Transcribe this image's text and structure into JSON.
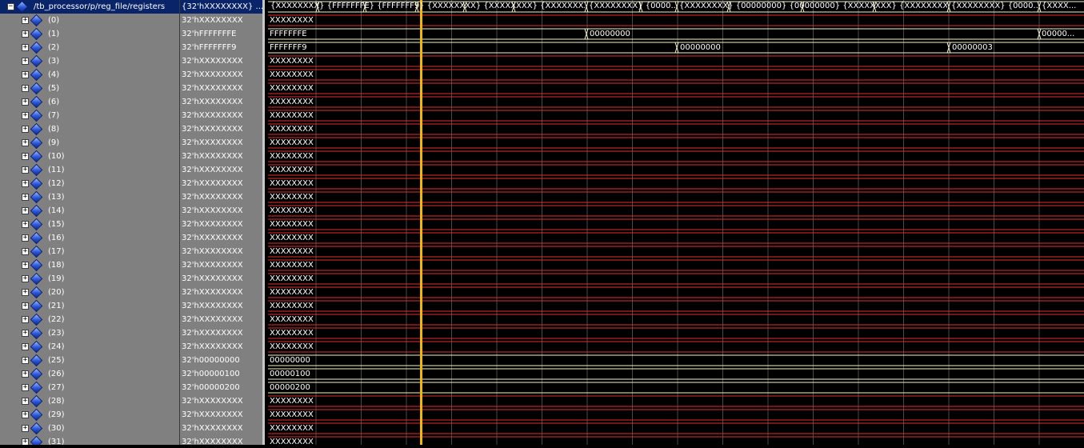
{
  "signal_list": {
    "root": {
      "name": "/tb_processor/p/reg_file/registers",
      "value": "{32'hXXXXXXXX} ...",
      "expanded": true
    },
    "children": [
      {
        "name": "(0)",
        "value": "32'hXXXXXXXX"
      },
      {
        "name": "(1)",
        "value": "32'hFFFFFFFE"
      },
      {
        "name": "(2)",
        "value": "32'hFFFFFFF9"
      },
      {
        "name": "(3)",
        "value": "32'hXXXXXXXX"
      },
      {
        "name": "(4)",
        "value": "32'hXXXXXXXX"
      },
      {
        "name": "(5)",
        "value": "32'hXXXXXXXX"
      },
      {
        "name": "(6)",
        "value": "32'hXXXXXXXX"
      },
      {
        "name": "(7)",
        "value": "32'hXXXXXXXX"
      },
      {
        "name": "(8)",
        "value": "32'hXXXXXXXX"
      },
      {
        "name": "(9)",
        "value": "32'hXXXXXXXX"
      },
      {
        "name": "(10)",
        "value": "32'hXXXXXXXX"
      },
      {
        "name": "(11)",
        "value": "32'hXXXXXXXX"
      },
      {
        "name": "(12)",
        "value": "32'hXXXXXXXX"
      },
      {
        "name": "(13)",
        "value": "32'hXXXXXXXX"
      },
      {
        "name": "(14)",
        "value": "32'hXXXXXXXX"
      },
      {
        "name": "(15)",
        "value": "32'hXXXXXXXX"
      },
      {
        "name": "(16)",
        "value": "32'hXXXXXXXX"
      },
      {
        "name": "(17)",
        "value": "32'hXXXXXXXX"
      },
      {
        "name": "(18)",
        "value": "32'hXXXXXXXX"
      },
      {
        "name": "(19)",
        "value": "32'hXXXXXXXX"
      },
      {
        "name": "(20)",
        "value": "32'hXXXXXXXX"
      },
      {
        "name": "(21)",
        "value": "32'hXXXXXXXX"
      },
      {
        "name": "(22)",
        "value": "32'hXXXXXXXX"
      },
      {
        "name": "(23)",
        "value": "32'hXXXXXXXX"
      },
      {
        "name": "(24)",
        "value": "32'hXXXXXXXX"
      },
      {
        "name": "(25)",
        "value": "32'h00000000"
      },
      {
        "name": "(26)",
        "value": "32'h00000100"
      },
      {
        "name": "(27)",
        "value": "32'h00000200"
      },
      {
        "name": "(28)",
        "value": "32'hXXXXXXXX"
      },
      {
        "name": "(29)",
        "value": "32'hXXXXXXXX"
      },
      {
        "name": "(30)",
        "value": "32'hXXXXXXXX"
      },
      {
        "name": "(31)",
        "value": "32'hXXXXXXXX"
      }
    ]
  },
  "waveform": {
    "top_row_labels": [
      "{XXXXXXXX} {FFFFFFFE} {FFFFFFF9} {XXXXXXXX} {XXXXXXXX} {XXXXXXXX} {X...",
      "{XXXXXXXX} {0000...",
      "{XXXXXXXX} {00000000} {00000000} {XXXXXXXX} {XXXXXXXX} {X...",
      "{XXXXXXXX} {0000...",
      "{XXXX..."
    ],
    "row_events": {
      "1": [
        "FFFFFFFE",
        "00000000",
        "00000..."
      ],
      "2": [
        "FFFFFFF9",
        "00000000",
        "00000003"
      ]
    },
    "unknown_label": "XXXXXXXX",
    "colors": {
      "unknown": "#e03030",
      "known": "#f2f2d0",
      "grid": "#4a4a4a",
      "cursor": "#f0b800",
      "selection": "#0a246a"
    }
  }
}
